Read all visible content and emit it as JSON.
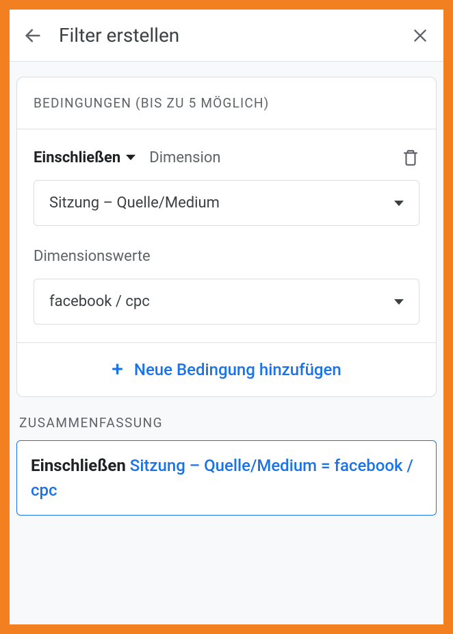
{
  "header": {
    "title": "Filter erstellen"
  },
  "conditions": {
    "section_title": "BEDINGUNGEN (BIS ZU 5 MÖGLICH)",
    "include_label": "Einschließen",
    "type_label": "Dimension",
    "dimension_value": "Sitzung – Quelle/Medium",
    "values_label": "Dimensionswerte",
    "value_selected": "facebook / cpc",
    "add_label": "Neue Bedingung hinzufügen"
  },
  "summary": {
    "section_title": "ZUSAMMENFASSUNG",
    "include": "Einschließen",
    "expression": "Sitzung – Quelle/Medium = facebook / cpc"
  }
}
